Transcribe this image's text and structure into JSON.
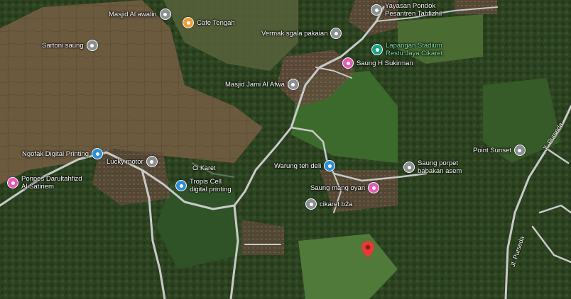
{
  "colors": {
    "grey_pin": "#8a8f93",
    "blue_pin": "#2e8fd6",
    "orange_pin": "#f29c38",
    "pink_pin": "#e35ab8",
    "teal_pin": "#18a383",
    "red_pin": "#e53935",
    "road": "#c9c9c9"
  },
  "places": [
    {
      "id": "masjid-al-awalin",
      "label": "Masjid Al awalin",
      "icon": "mosque-icon",
      "color": "grey"
    },
    {
      "id": "cafe-tengah",
      "label": "Cafe Tengah",
      "icon": "cafe-icon",
      "color": "orange"
    },
    {
      "id": "yayasan-pondok",
      "label": "Yayasan Pondok\nPesantren Tahfizhil",
      "icon": "school-icon",
      "color": "grey"
    },
    {
      "id": "sartoni-saung",
      "label": "Sartoni saung",
      "icon": "place-icon",
      "color": "grey"
    },
    {
      "id": "vermak",
      "label": "Vermak sgala pakaian",
      "icon": "place-icon",
      "color": "grey"
    },
    {
      "id": "lapangan",
      "label": "Lapangan Stadium\nRestu Jaya Cikaret",
      "icon": "park-icon",
      "color": "teal"
    },
    {
      "id": "saung-h-sukirman",
      "label": "Saung H Sukirman",
      "icon": "dining-icon",
      "color": "pink"
    },
    {
      "id": "masjid-jami",
      "label": "Masjid Jami Al Afwa",
      "icon": "mosque-icon",
      "color": "grey"
    },
    {
      "id": "ngofak",
      "label": "Ngofak Digital Printing",
      "icon": "shop-icon",
      "color": "blue"
    },
    {
      "id": "lucky-motor",
      "label": "Lucky motor",
      "icon": "place-icon",
      "color": "grey"
    },
    {
      "id": "warung-teh-deli",
      "label": "Warung teh deli",
      "icon": "shop-icon",
      "color": "blue"
    },
    {
      "id": "saung-porpet",
      "label": "Saung porpet\nbabakan asem",
      "icon": "place-icon",
      "color": "grey"
    },
    {
      "id": "point-sunset",
      "label": "Point Sunset",
      "icon": "place-icon",
      "color": "grey"
    },
    {
      "id": "ponpes",
      "label": "Ponpes Darultahfizd\nAl Satiriem",
      "icon": "dining-icon",
      "color": "pink"
    },
    {
      "id": "tropis-cell",
      "label": "Tropis Cell\ndigital printing",
      "icon": "shop-icon",
      "color": "blue"
    },
    {
      "id": "saung-mang-oyan",
      "label": "Saung mang oyan",
      "icon": "dining-icon",
      "color": "pink"
    },
    {
      "id": "cikaret-b2a",
      "label": "cikaret b2a",
      "icon": "place-icon",
      "color": "grey"
    }
  ],
  "roads": {
    "ci_karet": "Ci Karet",
    "jl_purseda_top": "Jl. Purseda",
    "jl_purseda_bottom": "Jl. Purseda"
  }
}
